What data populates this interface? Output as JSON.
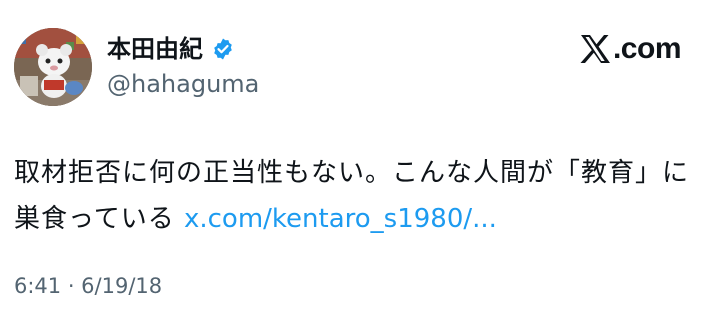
{
  "author": {
    "display_name": "本田由紀",
    "handle": "@hahaguma",
    "verified": true,
    "avatar_icon": "avatar-mascot-image",
    "verified_icon": "verified-badge-icon"
  },
  "brand": {
    "x_icon": "x-logo-icon",
    "suffix": ".com"
  },
  "tweet": {
    "line1": "取材拒否に何の正当性もない。こんな人間が「教育」に",
    "line2_text": "巣食っている ",
    "link": "x.com/kentaro_s1980/..."
  },
  "meta": {
    "timestamp": "6:41 · 6/19/18"
  },
  "colors": {
    "text": "#0f1419",
    "secondary": "#536471",
    "link": "#1d9bf0",
    "verified": "#1d9bf0"
  }
}
